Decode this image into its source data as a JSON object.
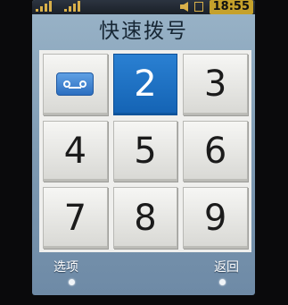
{
  "statusbar": {
    "time": "18:55"
  },
  "header": {
    "title": "快速拨号"
  },
  "keypad": {
    "keys": [
      {
        "label": "",
        "icon": "voicemail-icon"
      },
      {
        "label": "2"
      },
      {
        "label": "3"
      },
      {
        "label": "4"
      },
      {
        "label": "5"
      },
      {
        "label": "6"
      },
      {
        "label": "7"
      },
      {
        "label": "8"
      },
      {
        "label": "9"
      }
    ],
    "selected_key": "2"
  },
  "softkeys": {
    "left_label": "选项",
    "right_label": "返回"
  },
  "colors": {
    "selected": "#1a6cc0",
    "status_time_bg": "#c5a12b"
  }
}
